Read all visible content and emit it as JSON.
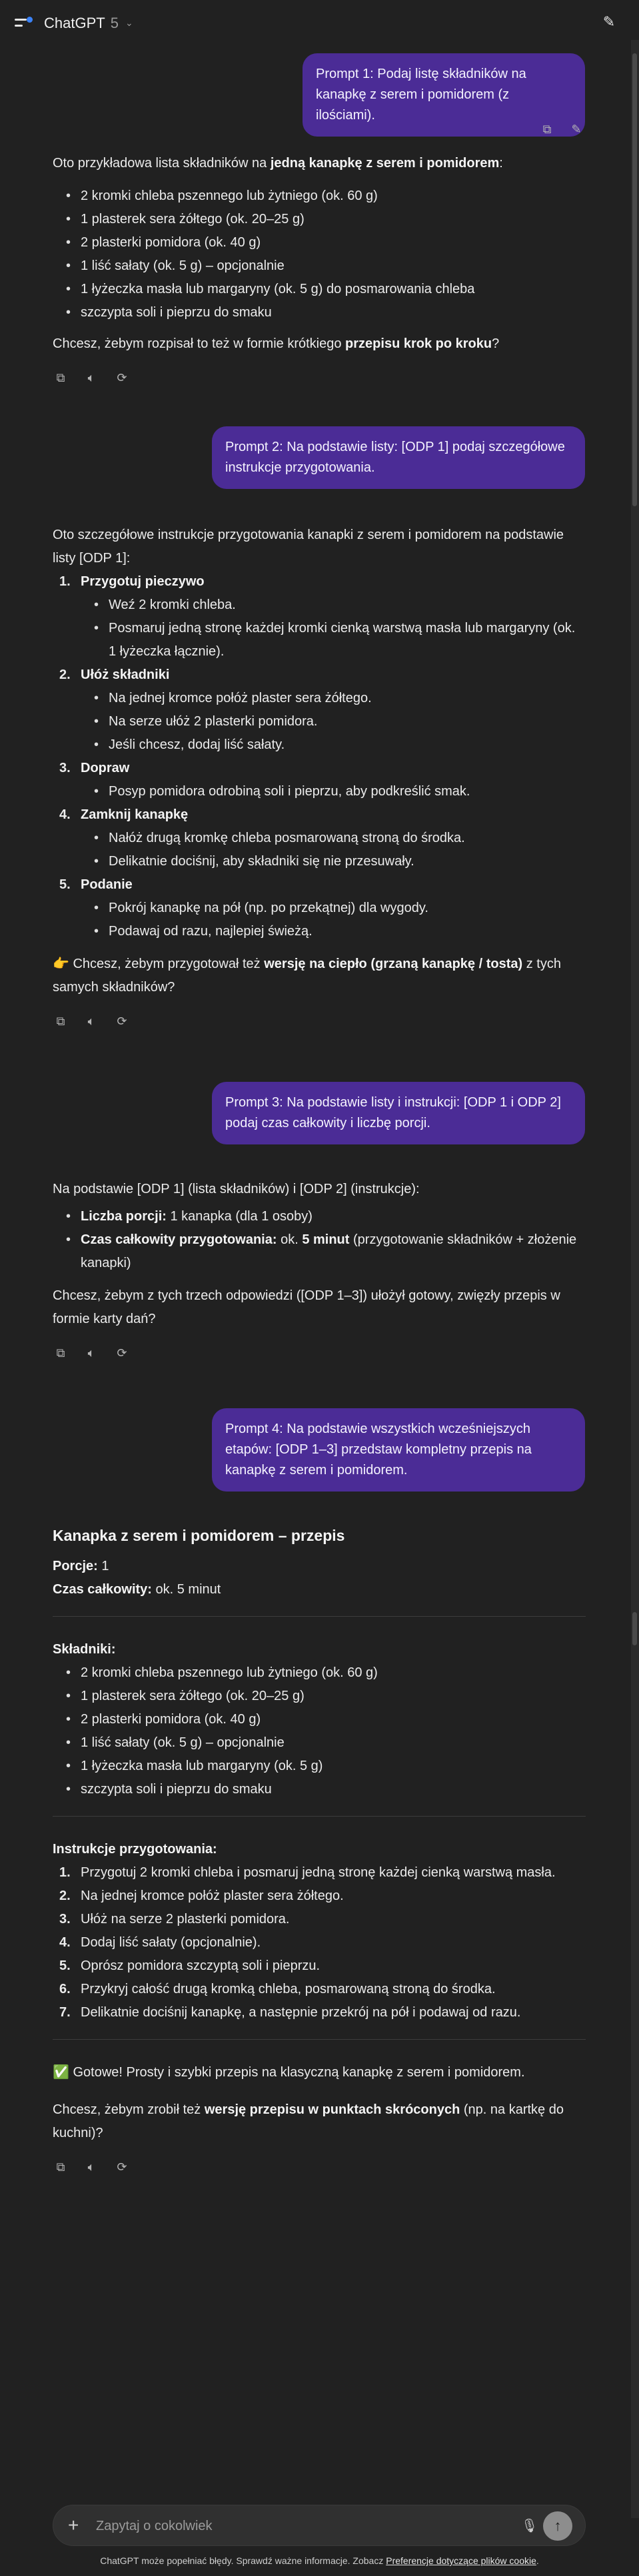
{
  "header": {
    "model_name": "ChatGPT",
    "model_version": "5"
  },
  "prompts": [
    "Prompt 1: Podaj listę składników na kanapkę z serem i pomidorem (z ilościami).",
    "Prompt 2: Na podstawie listy: [ODP 1] podaj szczegółowe instrukcje przygotowania.",
    "Prompt 3: Na podstawie listy i instrukcji: [ODP 1 i ODP 2] podaj czas całkowity i liczbę porcji.",
    "Prompt 4: Na podstawie wszystkich wcześniejszych etapów: [ODP 1–3] przedstaw kompletny przepis na kanapkę z serem i pomidorem."
  ],
  "answer1": {
    "intro_a": "Oto przykładowa lista składników na ",
    "intro_b": "jedną kanapkę z serem i pomidorem",
    "intro_c": ":",
    "items": [
      "2 kromki chleba pszennego lub żytniego (ok. 60 g)",
      "1 plasterek sera żółtego (ok. 20–25 g)",
      "2 plasterki pomidora (ok. 40 g)",
      "1 liść sałaty (ok. 5 g) – opcjonalnie",
      "1 łyżeczka masła lub margaryny (ok. 5 g) do posmarowania chleba",
      "szczypta soli i pieprzu do smaku"
    ],
    "follow_a": "Chcesz, żebym rozpisał to też w formie krótkiego ",
    "follow_b": "przepisu krok po kroku",
    "follow_c": "?"
  },
  "answer2": {
    "intro": "Oto szczegółowe instrukcje przygotowania kanapki z serem i pomidorem na podstawie listy [ODP 1]:",
    "steps": [
      {
        "title": "Przygotuj pieczywo",
        "subs": [
          "Weź 2 kromki chleba.",
          "Posmaruj jedną stronę każdej kromki cienką warstwą masła lub margaryny (ok. 1 łyżeczka łącznie)."
        ]
      },
      {
        "title": "Ułóż składniki",
        "subs": [
          "Na jednej kromce połóż plaster sera żółtego.",
          "Na serze ułóż 2 plasterki pomidora.",
          "Jeśli chcesz, dodaj liść sałaty."
        ]
      },
      {
        "title": "Dopraw",
        "subs": [
          "Posyp pomidora odrobiną soli i pieprzu, aby podkreślić smak."
        ]
      },
      {
        "title": "Zamknij kanapkę",
        "subs": [
          "Nałóż drugą kromkę chleba posmarowaną stroną do środka.",
          "Delikatnie dociśnij, aby składniki się nie przesuwały."
        ]
      },
      {
        "title": "Podanie",
        "subs": [
          "Pokrój kanapkę na pół (np. po przekątnej) dla wygody.",
          "Podawaj od razu, najlepiej świeżą."
        ]
      }
    ],
    "follow_a": "👉 Chcesz, żebym przygotował też ",
    "follow_b": "wersję na ciepło (grzaną kanapkę / tosta)",
    "follow_c": " z tych samych składników?"
  },
  "answer3": {
    "intro": "Na podstawie [ODP 1] (lista składników) i [ODP 2] (instrukcje):",
    "portion_label": "Liczba porcji:",
    "portion_value": " 1 kanapka (dla 1 osoby)",
    "time_label": "Czas całkowity przygotowania:",
    "time_value_a": " ok. ",
    "time_value_b": "5 minut",
    "time_value_c": " (przygotowanie składników + złożenie kanapki)",
    "follow": "Chcesz, żebym z tych trzech odpowiedzi ([ODP 1–3]) ułożył gotowy, zwięzły przepis w formie karty dań?"
  },
  "answer4": {
    "title": "Kanapka z serem i pomidorem – przepis",
    "portions_label": "Porcje:",
    "portions_value": " 1",
    "time_label": "Czas całkowity:",
    "time_value": " ok. 5 minut",
    "ingredients_title": "Składniki:",
    "ingredients": [
      "2 kromki chleba pszennego lub żytniego (ok. 60 g)",
      "1 plasterek sera żółtego (ok. 20–25 g)",
      "2 plasterki pomidora (ok. 40 g)",
      "1 liść sałaty (ok. 5 g) – opcjonalnie",
      "1 łyżeczka masła lub margaryny (ok. 5 g)",
      "szczypta soli i pieprzu do smaku"
    ],
    "instructions_title": "Instrukcje przygotowania:",
    "instructions": [
      "Przygotuj 2 kromki chleba i posmaruj jedną stronę każdej cienką warstwą masła.",
      "Na jednej kromce połóż plaster sera żółtego.",
      "Ułóż na serze 2 plasterki pomidora.",
      "Dodaj liść sałaty (opcjonalnie).",
      "Oprósz pomidora szczyptą soli i pieprzu.",
      "Przykryj całość drugą kromką chleba, posmarowaną stroną do środka.",
      "Delikatnie dociśnij kanapkę, a następnie przekrój na pół i podawaj od razu."
    ],
    "done": "✅ Gotowe! Prosty i szybki przepis na klasyczną kanapkę z serem i pomidorem.",
    "follow_a": "Chcesz, żebym zrobił też ",
    "follow_b": "wersję przepisu w punktach skróconych",
    "follow_c": " (np. na kartkę do kuchni)?"
  },
  "composer": {
    "placeholder": "Zapytaj o cokolwiek"
  },
  "disclaimer": {
    "text": "ChatGPT może popełniać błędy. Sprawdź ważne informacje. Zobacz ",
    "link": "Preferencje dotyczące plików cookie",
    "end": "."
  },
  "icons": {
    "copy": "copy-icon",
    "edit": "edit-icon",
    "read_aloud": "speaker-icon",
    "regenerate": "regenerate-icon",
    "mic": "microphone-icon",
    "send": "send-arrow-icon",
    "plus": "plus-icon",
    "menu": "sidebar-menu-icon",
    "new_chat": "new-chat-icon"
  },
  "colors": {
    "background": "#212121",
    "user_bubble": "#4b2c96",
    "accent_dot": "#3b82f6"
  }
}
